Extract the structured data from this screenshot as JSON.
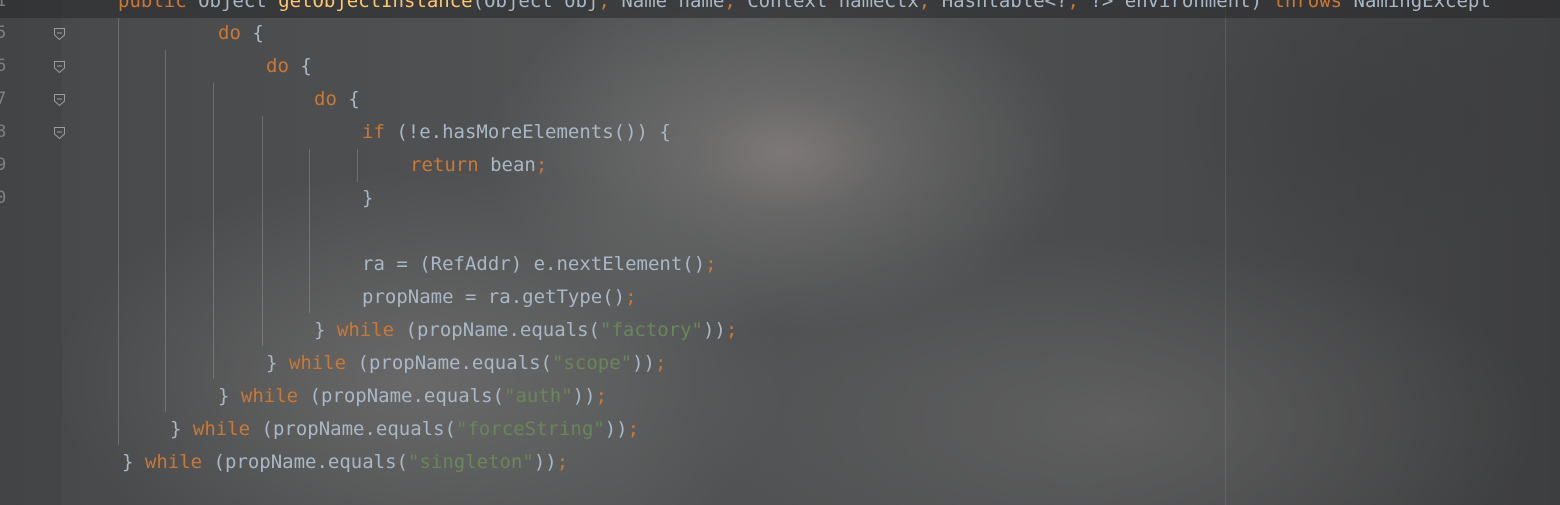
{
  "editor": {
    "top_line": {
      "parts": [
        {
          "t": "public ",
          "c": "kw"
        },
        {
          "t": "Object ",
          "c": "id"
        },
        {
          "t": "getObjectInstance",
          "c": "fn"
        },
        {
          "t": "(Object obj",
          "c": "id"
        },
        {
          "t": ", ",
          "c": "semi"
        },
        {
          "t": "Name name",
          "c": "id"
        },
        {
          "t": ", ",
          "c": "semi"
        },
        {
          "t": "Context nameCtx",
          "c": "id"
        },
        {
          "t": ", ",
          "c": "semi"
        },
        {
          "t": "Hashtable<?",
          "c": "id"
        },
        {
          "t": ", ",
          "c": "semi"
        },
        {
          "t": "?> environment) ",
          "c": "id"
        },
        {
          "t": "throws ",
          "c": "kw"
        },
        {
          "t": "NamingExcept",
          "c": "id"
        }
      ]
    },
    "line_numbers": [
      "1",
      "5",
      "6",
      "7",
      "8",
      "9",
      "0"
    ],
    "fold_markers": [
      "fold-5",
      "fold-6",
      "fold-7",
      "fold-8"
    ],
    "lines": [
      {
        "indent": 4,
        "parts": [
          {
            "t": "do ",
            "c": "kw"
          },
          {
            "t": "{",
            "c": "punc"
          }
        ]
      },
      {
        "indent": 5,
        "parts": [
          {
            "t": "do ",
            "c": "kw"
          },
          {
            "t": "{",
            "c": "punc"
          }
        ]
      },
      {
        "indent": 6,
        "parts": [
          {
            "t": "do ",
            "c": "kw"
          },
          {
            "t": "{",
            "c": "punc"
          }
        ]
      },
      {
        "indent": 7,
        "parts": [
          {
            "t": "if ",
            "c": "kw"
          },
          {
            "t": "(!e.hasMoreElements()) {",
            "c": "id"
          }
        ]
      },
      {
        "indent": 8,
        "parts": [
          {
            "t": "return ",
            "c": "kw"
          },
          {
            "t": "bean",
            "c": "id"
          },
          {
            "t": ";",
            "c": "semi"
          }
        ]
      },
      {
        "indent": 7,
        "parts": [
          {
            "t": "}",
            "c": "punc"
          }
        ]
      },
      {
        "indent": 0,
        "parts": []
      },
      {
        "indent": 7,
        "parts": [
          {
            "t": "ra = (RefAddr) e.nextElement()",
            "c": "id"
          },
          {
            "t": ";",
            "c": "semi"
          }
        ]
      },
      {
        "indent": 7,
        "parts": [
          {
            "t": "propName = ra.getType()",
            "c": "id"
          },
          {
            "t": ";",
            "c": "semi"
          }
        ]
      },
      {
        "indent": 6,
        "parts": [
          {
            "t": "} ",
            "c": "punc"
          },
          {
            "t": "while ",
            "c": "kw"
          },
          {
            "t": "(propName.equals(",
            "c": "id"
          },
          {
            "t": "\"factory\"",
            "c": "str"
          },
          {
            "t": "))",
            "c": "id"
          },
          {
            "t": ";",
            "c": "semi"
          }
        ]
      },
      {
        "indent": 5,
        "parts": [
          {
            "t": "} ",
            "c": "punc"
          },
          {
            "t": "while ",
            "c": "kw"
          },
          {
            "t": "(propName.equals(",
            "c": "id"
          },
          {
            "t": "\"scope\"",
            "c": "str"
          },
          {
            "t": "))",
            "c": "id"
          },
          {
            "t": ";",
            "c": "semi"
          }
        ]
      },
      {
        "indent": 4,
        "parts": [
          {
            "t": "} ",
            "c": "punc"
          },
          {
            "t": "while ",
            "c": "kw"
          },
          {
            "t": "(propName.equals(",
            "c": "id"
          },
          {
            "t": "\"auth\"",
            "c": "str"
          },
          {
            "t": "))",
            "c": "id"
          },
          {
            "t": ";",
            "c": "semi"
          }
        ]
      },
      {
        "indent": 3,
        "parts": [
          {
            "t": "} ",
            "c": "punc"
          },
          {
            "t": "while ",
            "c": "kw"
          },
          {
            "t": "(propName.equals(",
            "c": "id"
          },
          {
            "t": "\"forceString\"",
            "c": "str"
          },
          {
            "t": "))",
            "c": "id"
          },
          {
            "t": ";",
            "c": "semi"
          }
        ]
      },
      {
        "indent": 2,
        "parts": [
          {
            "t": "} ",
            "c": "punc"
          },
          {
            "t": "while ",
            "c": "kw"
          },
          {
            "t": "(propName.equals(",
            "c": "id"
          },
          {
            "t": "\"singleton\"",
            "c": "str"
          },
          {
            "t": "))",
            "c": "id"
          },
          {
            "t": ";",
            "c": "semi"
          }
        ]
      }
    ]
  },
  "colors": {
    "keyword": "#cc7832",
    "string": "#6a8759",
    "identifier": "#a9b7c6",
    "function": "#ffc66d"
  }
}
